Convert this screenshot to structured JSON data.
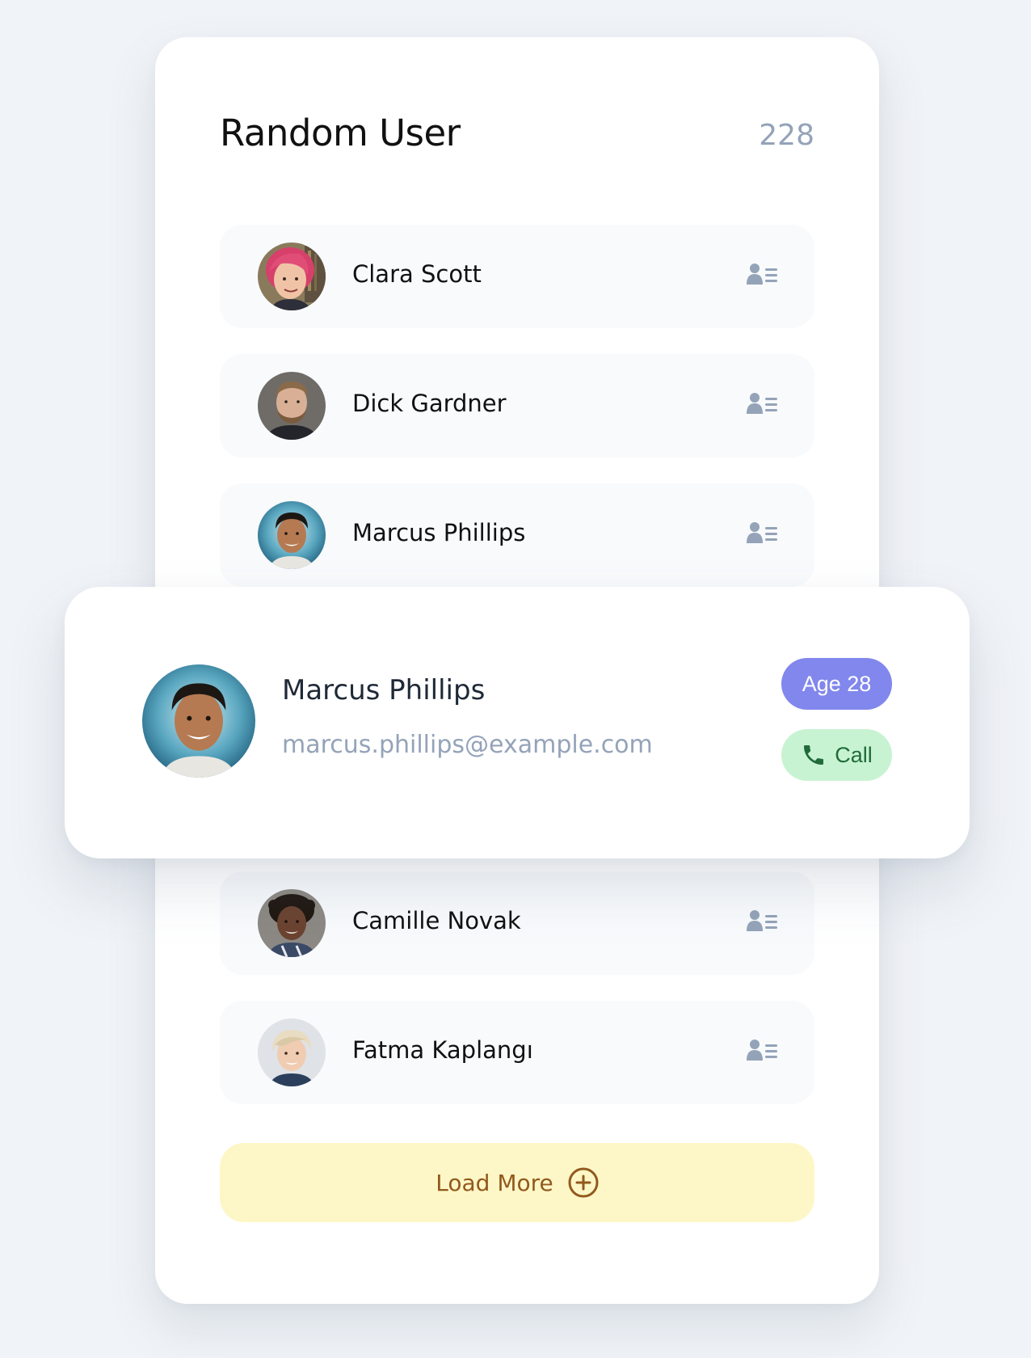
{
  "header": {
    "title": "Random User",
    "count": "228"
  },
  "users": [
    {
      "name": "Clara Scott",
      "avatar_icon": "user-photo",
      "action_icon": "contact-card-icon"
    },
    {
      "name": "Dick Gardner",
      "avatar_icon": "user-photo",
      "action_icon": "contact-card-icon"
    },
    {
      "name": "Marcus Phillips",
      "avatar_icon": "user-photo",
      "action_icon": "contact-card-icon"
    },
    {
      "name": "Camille Novak",
      "avatar_icon": "user-photo",
      "action_icon": "contact-card-icon"
    },
    {
      "name": "Fatma Kaplangı",
      "avatar_icon": "user-photo",
      "action_icon": "contact-card-icon"
    }
  ],
  "selected_user": {
    "name": "Marcus Phillips",
    "email": "marcus.phillips@example.com",
    "age_label": "Age 28",
    "call_label": "Call",
    "call_icon": "phone-icon"
  },
  "load_more": {
    "label": "Load More",
    "icon": "plus-circle-icon"
  },
  "colors": {
    "page_background": "#f0f3f7",
    "card_background": "#ffffff",
    "row_background": "#f8fafc",
    "muted_text": "#94a3b8",
    "age_badge": "#8187ec",
    "call_button": "#c8f3d3",
    "call_text": "#216b3a",
    "load_more_background": "#fdf7c7",
    "load_more_text": "#92591d"
  }
}
